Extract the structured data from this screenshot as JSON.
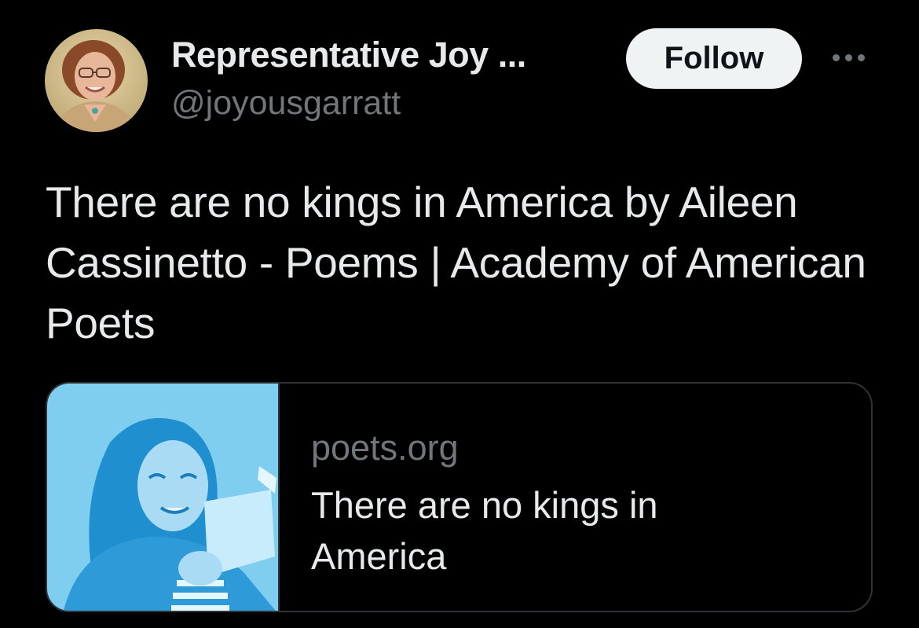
{
  "author": {
    "display_name": "Representative Joy ...",
    "handle": "@joyousgarratt",
    "avatar_icon": "profile-photo"
  },
  "actions": {
    "follow_label": "Follow",
    "more_icon": "more-horizontal-icon"
  },
  "tweet": {
    "text": "There are no kings in America by Aileen Cassinetto - Poems | Academy of American Poets"
  },
  "link_card": {
    "domain": "poets.org",
    "title": "There are no kings in America",
    "thumbnail_icon": "poet-portrait"
  },
  "colors": {
    "background": "#000000",
    "text_primary": "#e7e9ea",
    "text_secondary": "#71767b",
    "follow_button_bg": "#eff3f4",
    "card_border": "#2f3336",
    "thumbnail_tint": "#5bbbe8"
  }
}
